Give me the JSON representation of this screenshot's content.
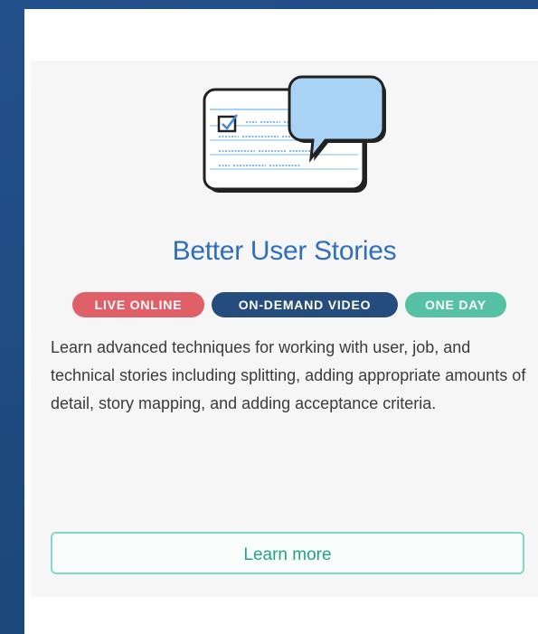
{
  "course": {
    "title": "Better User Stories",
    "illustration_icon": "user-story-card-with-speech-bubble",
    "badges": [
      {
        "label": "LIVE ONLINE",
        "color": "#e0606a"
      },
      {
        "label": "ON-DEMAND VIDEO",
        "color": "#244c7d"
      },
      {
        "label": "ONE DAY",
        "color": "#56c1a5"
      }
    ],
    "description": "Learn advanced techniques for working with user, job, and technical stories including splitting, adding appropriate amounts of detail, story mapping, and adding acceptance criteria.",
    "cta_label": "Learn more"
  },
  "colors": {
    "background": "#1e4a80",
    "title": "#2f6fbd",
    "accent": "#23a288",
    "button_border": "#82d8c4",
    "speech_bubble": "#a9d3f5"
  }
}
